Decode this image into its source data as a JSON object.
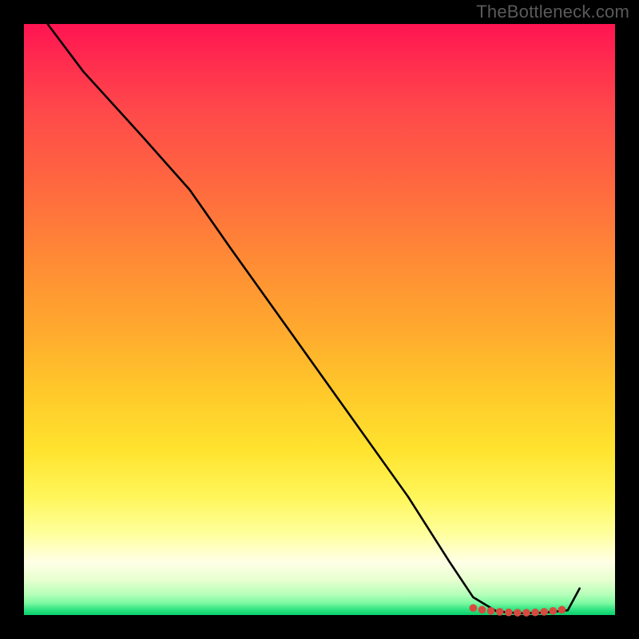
{
  "attribution": "TheBottleneck.com",
  "colors": {
    "background": "#000000",
    "attribution_text": "#5a5a5a",
    "line": "#000000",
    "marker_red": "#d84a3f",
    "gradient_top": "#ff1452",
    "gradient_bottom": "#08d06a"
  },
  "chart_data": {
    "type": "line",
    "title": "",
    "xlabel": "",
    "ylabel": "",
    "xlim": [
      0,
      100
    ],
    "ylim": [
      0,
      100
    ],
    "grid": false,
    "legend": false,
    "series": [
      {
        "name": "curve",
        "x": [
          4,
          10,
          20,
          28,
          35,
          45,
          55,
          65,
          72,
          76,
          80,
          84,
          88,
          92,
          94
        ],
        "values": [
          100,
          92,
          81,
          72,
          62,
          48,
          34,
          20,
          9,
          3,
          0.6,
          0.3,
          0.4,
          0.8,
          4.5
        ]
      }
    ],
    "markers": {
      "name": "highlight-points",
      "x": [
        76,
        77.5,
        79,
        80.5,
        82,
        83.5,
        85,
        86.5,
        88,
        89.5,
        91
      ],
      "values": [
        1.2,
        0.9,
        0.7,
        0.55,
        0.45,
        0.4,
        0.4,
        0.45,
        0.55,
        0.7,
        0.9
      ]
    }
  }
}
